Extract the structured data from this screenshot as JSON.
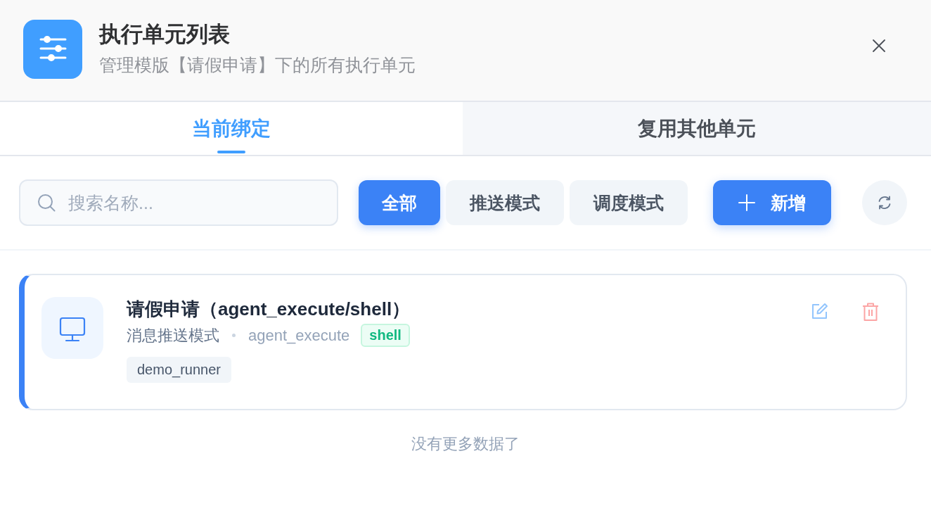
{
  "header": {
    "title": "执行单元列表",
    "subtitle": "管理模版【请假申请】下的所有执行单元"
  },
  "tabs": [
    {
      "label": "当前绑定",
      "selected": true
    },
    {
      "label": "复用其他单元",
      "selected": false
    }
  ],
  "search": {
    "placeholder": "搜索名称..."
  },
  "filters": [
    {
      "label": "全部",
      "selected": true
    },
    {
      "label": "推送模式",
      "selected": false
    },
    {
      "label": "调度模式",
      "selected": false
    }
  ],
  "add_button": {
    "label": "新增"
  },
  "units": [
    {
      "title": "请假申请（agent_execute/shell）",
      "mode": "消息推送模式",
      "executor": "agent_execute",
      "type_badge": "shell",
      "tags": [
        "demo_runner"
      ]
    }
  ],
  "footer": "没有更多数据了"
}
